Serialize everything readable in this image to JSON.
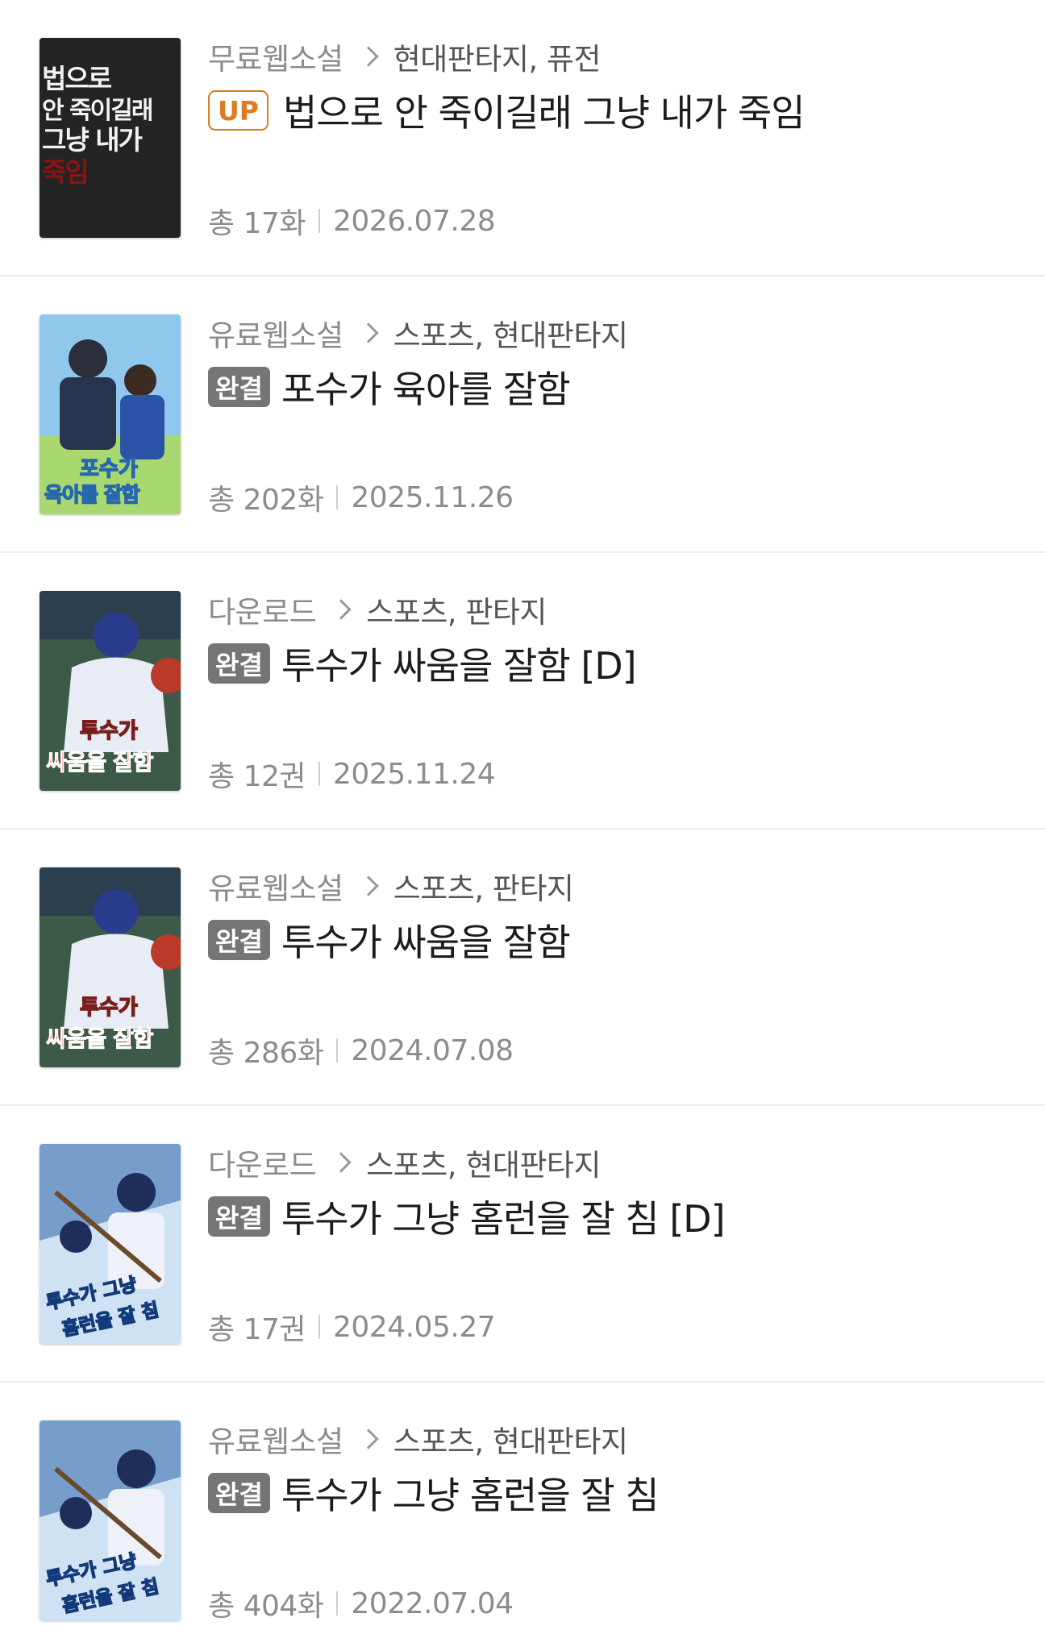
{
  "items": [
    {
      "platform": "무료웹소설",
      "genres": "현대판타지, 퓨전",
      "badge": "UP",
      "badge_type": "up",
      "title": "법으로 안 죽이길래 그냥 내가 죽임",
      "count": "총 17화",
      "date": "2026.07.28",
      "cover": {
        "style": "dark-text",
        "lines": [
          "법으로",
          "안 죽이길래",
          "그냥 내가",
          "죽임"
        ]
      }
    },
    {
      "platform": "유료웹소설",
      "genres": "스포츠, 현대판타지",
      "badge": "완결",
      "badge_type": "done",
      "title": "포수가 육아를 잘함",
      "count": "총 202화",
      "date": "2025.11.26",
      "cover": {
        "style": "catcher",
        "lines": [
          "포수가",
          "육아를 잘함"
        ]
      }
    },
    {
      "platform": "다운로드",
      "genres": "스포츠, 판타지",
      "badge": "완결",
      "badge_type": "done",
      "title": "투수가 싸움을 잘함 [D]",
      "count": "총 12권",
      "date": "2025.11.24",
      "cover": {
        "style": "pitcher",
        "lines": [
          "투수가",
          "싸움을 잘함"
        ]
      }
    },
    {
      "platform": "유료웹소설",
      "genres": "스포츠, 판타지",
      "badge": "완결",
      "badge_type": "done",
      "title": "투수가 싸움을 잘함",
      "count": "총 286화",
      "date": "2024.07.08",
      "cover": {
        "style": "pitcher",
        "lines": [
          "투수가",
          "싸움을 잘함"
        ]
      }
    },
    {
      "platform": "다운로드",
      "genres": "스포츠, 현대판타지",
      "badge": "완결",
      "badge_type": "done",
      "title": "투수가 그냥 홈런을 잘 침 [D]",
      "count": "총 17권",
      "date": "2024.05.27",
      "cover": {
        "style": "batter",
        "lines": [
          "투수가 그냥",
          "홈런을 잘 침"
        ]
      }
    },
    {
      "platform": "유료웹소설",
      "genres": "스포츠, 현대판타지",
      "badge": "완결",
      "badge_type": "done",
      "title": "투수가 그냥 홈런을 잘 침",
      "count": "총 404화",
      "date": "2022.07.04",
      "cover": {
        "style": "batter",
        "lines": [
          "투수가 그냥",
          "홈런을 잘 침"
        ]
      }
    }
  ]
}
